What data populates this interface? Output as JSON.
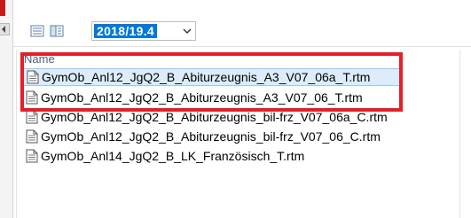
{
  "toolbar": {
    "list_view_icon": "list-view-icon",
    "details_view_icon": "details-pane-icon",
    "period_select": {
      "value": "2018/19.4"
    }
  },
  "list": {
    "column_header": "Name",
    "files": [
      {
        "name": "GymOb_Anl12_JgQ2_B_Abiturzeugnis_A3_V07_06a_T.rtm",
        "icon": "document-icon",
        "selected": true
      },
      {
        "name": "GymOb_Anl12_JgQ2_B_Abiturzeugnis_A3_V07_06_T.rtm",
        "icon": "document-icon",
        "selected": false
      },
      {
        "name": "GymOb_Anl12_JgQ2_B_Abiturzeugnis_bil-frz_V07_06a_C.rtm",
        "icon": "document-icon",
        "selected": false
      },
      {
        "name": "GymOb_Anl12_JgQ2_B_Abiturzeugnis_bil-frz_V07_06_C.rtm",
        "icon": "document-icon",
        "selected": false
      },
      {
        "name": "GymOb_Anl14_JgQ2_B_LK_Französisch_T.rtm",
        "icon": "document-icon",
        "selected": false
      }
    ]
  },
  "colors": {
    "highlight": "#e3202a",
    "selection": "#dcecfb",
    "accent": "#0078d7"
  }
}
